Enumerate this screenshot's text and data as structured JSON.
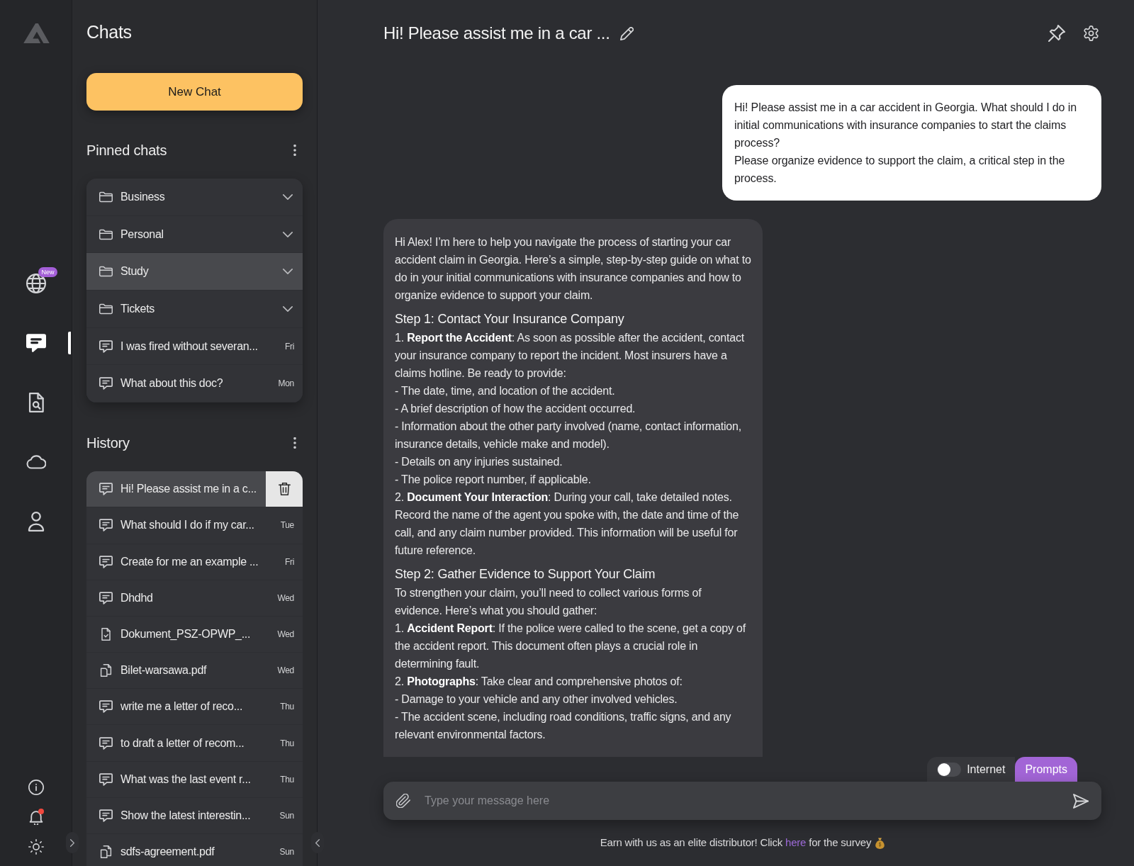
{
  "rail": {
    "nav": [
      {
        "kind": "globe",
        "badge": "New",
        "selected": false
      },
      {
        "kind": "chat",
        "selected": true
      },
      {
        "kind": "document-search",
        "selected": false
      },
      {
        "kind": "cloud",
        "selected": false
      },
      {
        "kind": "user",
        "selected": false
      }
    ],
    "bottom": [
      {
        "kind": "info"
      },
      {
        "kind": "bell",
        "notification": true
      },
      {
        "kind": "sun"
      }
    ]
  },
  "sidebar": {
    "title": "Chats",
    "new_chat_button": "New Chat",
    "pinned": {
      "title": "Pinned chats",
      "items": [
        {
          "kind": "folder",
          "label": "Business",
          "selected": false
        },
        {
          "kind": "folder",
          "label": "Personal",
          "selected": false
        },
        {
          "kind": "folder",
          "label": "Study",
          "selected": true
        },
        {
          "kind": "folder",
          "label": "Tickets",
          "selected": false
        },
        {
          "kind": "chat",
          "label": "I was fired without severan...",
          "date": "Fri",
          "selected": false
        },
        {
          "kind": "chat",
          "label": "What about this doc?",
          "date": "Mon",
          "selected": false
        }
      ]
    },
    "history": {
      "title": "History",
      "items": [
        {
          "kind": "chat",
          "label": "Hi! Please assist me in a c...",
          "selected": true
        },
        {
          "kind": "chat",
          "label": "What should I do if my car...",
          "date": "Tue",
          "selected": false
        },
        {
          "kind": "chat",
          "label": "Create for me an example ...",
          "date": "Fri",
          "selected": false
        },
        {
          "kind": "chat",
          "label": "Dhdhd",
          "date": "Wed",
          "selected": false
        },
        {
          "kind": "file",
          "label": "Dokument_PSZ-OPWP_...",
          "date": "Wed",
          "selected": false
        },
        {
          "kind": "pdf",
          "label": "Bilet-warsawa.pdf",
          "date": "Wed",
          "selected": false
        },
        {
          "kind": "chat",
          "label": "write me a letter of reco...",
          "date": "Thu",
          "selected": false
        },
        {
          "kind": "chat",
          "label": "to draft a letter of recom...",
          "date": "Thu",
          "selected": false
        },
        {
          "kind": "chat",
          "label": "What was the last event r...",
          "date": "Thu",
          "selected": false
        },
        {
          "kind": "chat",
          "label": "Show the latest interestin...",
          "date": "Sun",
          "selected": false
        },
        {
          "kind": "pdf",
          "label": "sdfs-agreement.pdf",
          "date": "Sun",
          "selected": false
        }
      ]
    }
  },
  "conversation": {
    "title": "Hi! Please assist me in a car ...",
    "messages": [
      {
        "kind": "user",
        "paragraphs": [
          "Hi! Please assist me in a car accident in Georgia. What should I do in initial communications with insurance companies to start the claims process?",
          "Please organize evidence to support the claim, a critical step in the process."
        ]
      },
      {
        "kind": "assistant",
        "blocks": [
          {
            "kind": "paragraph",
            "text": "Hi Alex! I’m here to help you navigate the process of starting your car accident claim in Georgia. Here’s a simple, step-by-step guide on what to do in your initial communications with insurance companies and how to organize evidence to support your claim."
          },
          {
            "kind": "heading",
            "text": "Step 1: Contact Your Insurance Company"
          },
          {
            "kind": "paragraph",
            "text": "1. **Report the Accident**: As soon as possible after the accident, contact your insurance company to report the incident. Most insurers have a claims hotline. Be ready to provide:"
          },
          {
            "kind": "paragraph",
            "text": "- The date, time, and location of the accident."
          },
          {
            "kind": "paragraph",
            "text": "- A brief description of how the accident occurred."
          },
          {
            "kind": "paragraph",
            "text": "- Information about the other party involved (name, contact information, insurance details, vehicle make and model)."
          },
          {
            "kind": "paragraph",
            "text": "- Details on any injuries sustained."
          },
          {
            "kind": "paragraph",
            "text": "- The police report number, if applicable."
          },
          {
            "kind": "paragraph",
            "text": "2. **Document Your Interaction**: During your call, take detailed notes. Record the name of the agent you spoke with, the date and time of the call, and any claim number provided. This information will be useful for future reference."
          },
          {
            "kind": "heading",
            "text": "Step 2: Gather Evidence to Support Your Claim"
          },
          {
            "kind": "paragraph",
            "text": "To strengthen your claim, you’ll need to collect various forms of evidence. Here’s what you should gather:"
          },
          {
            "kind": "paragraph",
            "text": "1. **Accident Report**: If the police were called to the scene, get a copy of the accident report. This document often plays a crucial role in determining fault."
          },
          {
            "kind": "paragraph",
            "text": "2. **Photographs**: Take clear and comprehensive photos of:"
          },
          {
            "kind": "paragraph",
            "text": "- Damage to your vehicle and any other involved vehicles."
          },
          {
            "kind": "paragraph",
            "text": "- The accident scene, including road conditions, traffic signs, and any relevant environmental factors."
          }
        ]
      }
    ]
  },
  "composer": {
    "internet_toggle": {
      "label": "Internet",
      "on": false
    },
    "prompts_button": "Prompts",
    "placeholder": "Type your message here"
  },
  "footer": {
    "before": "Earn with us as an elite distributor! Click",
    "link": "here",
    "after": "for the survey"
  }
}
